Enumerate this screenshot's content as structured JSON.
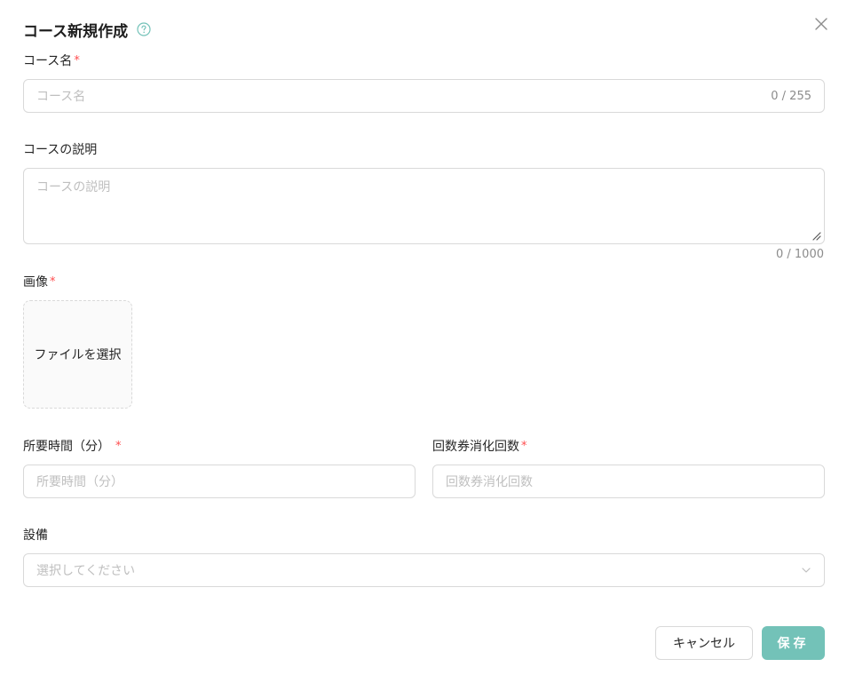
{
  "modal": {
    "title": "コース新規作成",
    "help_icon": "question-circle-icon",
    "close_icon": "close-icon"
  },
  "fields": {
    "course_name": {
      "label": "コース名",
      "required_mark": "*",
      "placeholder": "コース名",
      "counter": "0 / 255"
    },
    "description": {
      "label": "コースの説明",
      "placeholder": "コースの説明",
      "counter": "0 / 1000"
    },
    "image": {
      "label": "画像",
      "required_mark": "*",
      "upload_label": "ファイルを選択"
    },
    "duration": {
      "label": "所要時間（分）",
      "required_mark": "*",
      "placeholder": "所要時間（分）"
    },
    "ticket_count": {
      "label": "回数券消化回数",
      "required_mark": "*",
      "placeholder": "回数券消化回数"
    },
    "equipment": {
      "label": "設備",
      "placeholder": "選択してください",
      "icon": "chevron-down-icon"
    }
  },
  "actions": {
    "cancel_label": "キャンセル",
    "save_label": "保存"
  },
  "colors": {
    "primary": "#73c2b8",
    "required": "#ff4d4f",
    "border": "#d9d9d9",
    "placeholder": "#bfbfbf"
  }
}
